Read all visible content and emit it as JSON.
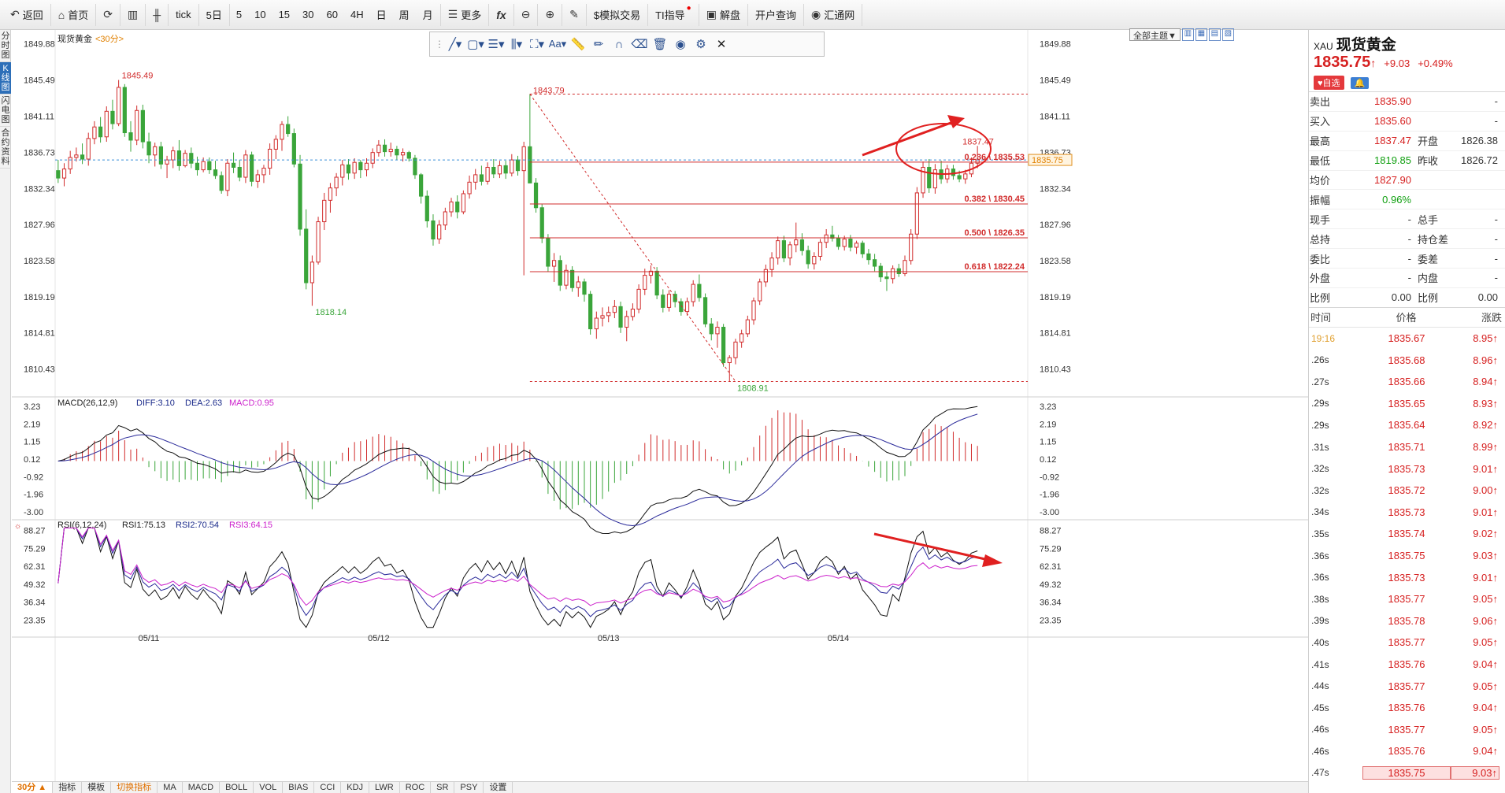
{
  "toolbar": {
    "back": "返回",
    "home": "首页",
    "tick": "tick",
    "period_5d": "5日",
    "p5": "5",
    "p10": "10",
    "p15": "15",
    "p30": "30",
    "p60": "60",
    "p4h": "4H",
    "day": "日",
    "week": "周",
    "month": "月",
    "more": "更多",
    "sim_trade": "$模拟交易",
    "ti": "TI指导",
    "unlock": "解盘",
    "account": "开户查询",
    "fx": "汇通网"
  },
  "left_tabs": [
    "分时图",
    "K线图",
    "闪电图",
    "合约资料"
  ],
  "chart": {
    "title": "现货黄金",
    "period": "<30分>",
    "theme_select": "全部主题▼",
    "price_ticks": [
      "1849.88",
      "1845.49",
      "1841.11",
      "1836.73",
      "1832.34",
      "1827.96",
      "1823.58",
      "1819.19",
      "1814.81",
      "1810.43"
    ],
    "current_price_tag": "1835.75",
    "annotations": {
      "high1": "1845.49",
      "low1": "1818.14",
      "high2": "1843.79",
      "low2": "1808.91",
      "high3": "1837.47"
    },
    "fib_levels": [
      {
        "label": "0.236 \\ 1835.53",
        "price": 1835.53
      },
      {
        "label": "0.382 \\ 1830.45",
        "price": 1830.45
      },
      {
        "label": "0.500 \\ 1826.35",
        "price": 1826.35
      },
      {
        "label": "0.618 \\ 1822.24",
        "price": 1822.24
      }
    ],
    "dates": [
      "05/11",
      "05/12",
      "05/13",
      "05/14"
    ],
    "macd": {
      "label": "MACD(26,12,9)",
      "diff": "DIFF:3.10",
      "dea": "DEA:2.63",
      "macd": "MACD:0.95",
      "ticks": [
        "3.23",
        "2.19",
        "1.15",
        "0.12",
        "-0.92",
        "-1.96",
        "-3.00"
      ]
    },
    "rsi": {
      "label": "RSI(6,12,24)",
      "rsi1": "RSI1:75.13",
      "rsi2": "RSI2:70.54",
      "rsi3": "RSI3:64.15",
      "ticks": [
        "88.27",
        "75.29",
        "62.31",
        "49.32",
        "36.34",
        "23.35"
      ]
    }
  },
  "bottom_bar": [
    "30分 ▲",
    "指标",
    "模板",
    "切换指标",
    "MA",
    "MACD",
    "BOLL",
    "VOL",
    "BIAS",
    "CCI",
    "KDJ",
    "LWR",
    "ROC",
    "SR",
    "PSY",
    "设置"
  ],
  "quote": {
    "code": "XAU",
    "name": "现货黄金",
    "last": "1835.75",
    "arrow": "↑",
    "change": "+9.03",
    "pct": "+0.49%",
    "fav": "♥自选",
    "bell": "🔔",
    "rows": [
      {
        "l1": "卖出",
        "v1": "1835.90",
        "c1": "red",
        "l2": "",
        "v2": "-"
      },
      {
        "l1": "买入",
        "v1": "1835.60",
        "c1": "red",
        "l2": "",
        "v2": "-"
      },
      {
        "l1": "最高",
        "v1": "1837.47",
        "c1": "red",
        "l2": "开盘",
        "v2": "1826.38",
        "c2": "green"
      },
      {
        "l1": "最低",
        "v1": "1819.85",
        "c1": "green",
        "l2": "昨收",
        "v2": "1826.72",
        "c2": "black"
      },
      {
        "l1": "均价",
        "v1": "1827.90",
        "c1": "red",
        "l2": "",
        "v2": ""
      },
      {
        "l1": "振幅",
        "v1": "0.96%",
        "c1": "green",
        "l2": "",
        "v2": ""
      },
      {
        "l1": "现手",
        "v1": "-",
        "c1": "black",
        "l2": "总手",
        "v2": "-"
      },
      {
        "l1": "总持",
        "v1": "-",
        "c1": "black",
        "l2": "持仓差",
        "v2": "-"
      },
      {
        "l1": "委比",
        "v1": "-",
        "c1": "black",
        "l2": "委差",
        "v2": "-"
      },
      {
        "l1": "外盘",
        "v1": "-",
        "c1": "black",
        "l2": "内盘",
        "v2": "-"
      },
      {
        "l1": "比例",
        "v1": "0.00",
        "c1": "black",
        "l2": "比例",
        "v2": "0.00"
      }
    ],
    "tick_header": {
      "time": "时间",
      "price": "价格",
      "change": "涨跌"
    },
    "ticks": [
      {
        "t": "19:16",
        "p": "1835.67",
        "c": "8.95"
      },
      {
        "t": ".26s",
        "p": "1835.68",
        "c": "8.96"
      },
      {
        "t": ".27s",
        "p": "1835.66",
        "c": "8.94"
      },
      {
        "t": ".29s",
        "p": "1835.65",
        "c": "8.93"
      },
      {
        "t": ".29s",
        "p": "1835.64",
        "c": "8.92"
      },
      {
        "t": ".31s",
        "p": "1835.71",
        "c": "8.99"
      },
      {
        "t": ".32s",
        "p": "1835.73",
        "c": "9.01"
      },
      {
        "t": ".32s",
        "p": "1835.72",
        "c": "9.00"
      },
      {
        "t": ".34s",
        "p": "1835.73",
        "c": "9.01"
      },
      {
        "t": ".35s",
        "p": "1835.74",
        "c": "9.02"
      },
      {
        "t": ".36s",
        "p": "1835.75",
        "c": "9.03"
      },
      {
        "t": ".36s",
        "p": "1835.73",
        "c": "9.01"
      },
      {
        "t": ".38s",
        "p": "1835.77",
        "c": "9.05"
      },
      {
        "t": ".39s",
        "p": "1835.78",
        "c": "9.06"
      },
      {
        "t": ".40s",
        "p": "1835.77",
        "c": "9.05"
      },
      {
        "t": ".41s",
        "p": "1835.76",
        "c": "9.04"
      },
      {
        "t": ".44s",
        "p": "1835.77",
        "c": "9.05"
      },
      {
        "t": ".45s",
        "p": "1835.76",
        "c": "9.04"
      },
      {
        "t": ".46s",
        "p": "1835.77",
        "c": "9.05"
      },
      {
        "t": ".46s",
        "p": "1835.76",
        "c": "9.04"
      },
      {
        "t": ".47s",
        "p": "1835.75",
        "c": "9.03"
      }
    ]
  },
  "chart_data": {
    "type": "candlestick",
    "title": "现货黄金",
    "price_range": [
      1808.0,
      1851.0
    ],
    "candles": [
      [
        1834.5,
        1835.8,
        1833.0,
        1833.6
      ],
      [
        1833.6,
        1835.4,
        1832.6,
        1834.7
      ],
      [
        1834.7,
        1836.9,
        1834.1,
        1836.1
      ],
      [
        1836.1,
        1837.3,
        1835.6,
        1836.4
      ],
      [
        1836.4,
        1837.8,
        1835.3,
        1835.9
      ],
      [
        1835.9,
        1839.1,
        1835.1,
        1838.4
      ],
      [
        1838.4,
        1840.5,
        1837.7,
        1839.8
      ],
      [
        1839.8,
        1841.0,
        1837.9,
        1838.6
      ],
      [
        1838.6,
        1842.3,
        1838.0,
        1841.7
      ],
      [
        1841.7,
        1843.1,
        1839.5,
        1840.2
      ],
      [
        1840.2,
        1845.5,
        1839.9,
        1844.6
      ],
      [
        1844.6,
        1845.0,
        1838.6,
        1839.1
      ],
      [
        1839.1,
        1840.5,
        1836.8,
        1838.2
      ],
      [
        1838.2,
        1842.4,
        1837.6,
        1841.8
      ],
      [
        1841.8,
        1842.5,
        1837.2,
        1838.0
      ],
      [
        1838.0,
        1839.1,
        1835.4,
        1836.4
      ],
      [
        1836.4,
        1837.9,
        1835.0,
        1837.4
      ],
      [
        1837.4,
        1838.0,
        1834.7,
        1835.3
      ],
      [
        1835.3,
        1836.3,
        1833.6,
        1835.8
      ],
      [
        1835.8,
        1837.4,
        1834.8,
        1836.9
      ],
      [
        1836.9,
        1838.2,
        1834.5,
        1835.1
      ],
      [
        1835.1,
        1837.0,
        1834.9,
        1836.6
      ],
      [
        1836.6,
        1837.3,
        1834.8,
        1835.4
      ],
      [
        1835.4,
        1836.2,
        1833.9,
        1834.6
      ],
      [
        1834.6,
        1836.1,
        1834.3,
        1835.6
      ],
      [
        1835.6,
        1836.1,
        1834.1,
        1834.6
      ],
      [
        1834.6,
        1835.7,
        1833.5,
        1833.9
      ],
      [
        1833.9,
        1834.4,
        1831.7,
        1832.1
      ],
      [
        1832.1,
        1835.9,
        1831.4,
        1835.4
      ],
      [
        1835.4,
        1836.7,
        1834.2,
        1834.9
      ],
      [
        1834.9,
        1835.8,
        1833.2,
        1833.7
      ],
      [
        1833.7,
        1837.0,
        1833.0,
        1836.4
      ],
      [
        1836.4,
        1836.8,
        1832.6,
        1833.2
      ],
      [
        1833.2,
        1834.6,
        1832.4,
        1834.0
      ],
      [
        1834.0,
        1835.2,
        1833.0,
        1834.8
      ],
      [
        1834.8,
        1837.8,
        1834.0,
        1837.1
      ],
      [
        1837.1,
        1838.8,
        1835.9,
        1838.3
      ],
      [
        1838.3,
        1840.5,
        1836.9,
        1840.1
      ],
      [
        1840.1,
        1841.1,
        1838.6,
        1839.0
      ],
      [
        1839.0,
        1839.6,
        1834.9,
        1835.3
      ],
      [
        1835.3,
        1836.4,
        1826.6,
        1827.4
      ],
      [
        1827.4,
        1829.8,
        1820.1,
        1820.9
      ],
      [
        1820.9,
        1824.2,
        1818.1,
        1823.4
      ],
      [
        1823.4,
        1828.9,
        1823.1,
        1828.3
      ],
      [
        1828.3,
        1831.8,
        1827.3,
        1830.9
      ],
      [
        1830.9,
        1833.0,
        1829.4,
        1832.4
      ],
      [
        1832.4,
        1834.2,
        1831.4,
        1833.7
      ],
      [
        1833.7,
        1835.8,
        1832.7,
        1835.2
      ],
      [
        1835.2,
        1835.9,
        1833.4,
        1834.2
      ],
      [
        1834.2,
        1836.0,
        1833.5,
        1835.5
      ],
      [
        1835.5,
        1835.8,
        1833.6,
        1834.6
      ],
      [
        1834.6,
        1836.0,
        1833.8,
        1835.4
      ],
      [
        1835.4,
        1837.2,
        1834.8,
        1836.7
      ],
      [
        1836.7,
        1838.2,
        1836.2,
        1837.6
      ],
      [
        1837.6,
        1838.3,
        1836.2,
        1836.8
      ],
      [
        1836.8,
        1837.9,
        1836.2,
        1837.1
      ],
      [
        1837.1,
        1837.5,
        1835.8,
        1836.4
      ],
      [
        1836.4,
        1837.2,
        1835.6,
        1836.7
      ],
      [
        1836.7,
        1836.9,
        1835.6,
        1836.0
      ],
      [
        1836.0,
        1836.4,
        1833.5,
        1834.0
      ],
      [
        1834.0,
        1834.2,
        1830.5,
        1831.4
      ],
      [
        1831.4,
        1832.1,
        1827.6,
        1828.4
      ],
      [
        1828.4,
        1829.2,
        1825.4,
        1826.2
      ],
      [
        1826.2,
        1828.5,
        1825.6,
        1827.9
      ],
      [
        1827.9,
        1830.0,
        1827.3,
        1829.5
      ],
      [
        1829.5,
        1831.2,
        1828.9,
        1830.7
      ],
      [
        1830.7,
        1831.5,
        1828.7,
        1829.5
      ],
      [
        1829.5,
        1832.1,
        1829.2,
        1831.7
      ],
      [
        1831.7,
        1833.9,
        1831.1,
        1833.1
      ],
      [
        1833.1,
        1834.7,
        1832.2,
        1834.0
      ],
      [
        1834.0,
        1835.1,
        1832.7,
        1833.2
      ],
      [
        1833.2,
        1835.5,
        1832.8,
        1834.9
      ],
      [
        1834.9,
        1835.9,
        1833.6,
        1834.1
      ],
      [
        1834.1,
        1835.7,
        1833.6,
        1835.1
      ],
      [
        1835.1,
        1835.7,
        1833.5,
        1834.2
      ],
      [
        1834.2,
        1836.5,
        1833.8,
        1835.8
      ],
      [
        1835.8,
        1836.3,
        1833.9,
        1834.5
      ],
      [
        1834.5,
        1838.0,
        1821.8,
        1837.4
      ],
      [
        1837.4,
        1843.8,
        1836.5,
        1833.0
      ],
      [
        1833.0,
        1833.6,
        1829.4,
        1830.0
      ],
      [
        1830.0,
        1830.4,
        1825.7,
        1826.3
      ],
      [
        1826.3,
        1826.8,
        1822.2,
        1822.9
      ],
      [
        1822.9,
        1824.5,
        1821.0,
        1823.6
      ],
      [
        1823.6,
        1824.2,
        1819.9,
        1820.6
      ],
      [
        1820.6,
        1823.1,
        1820.1,
        1822.4
      ],
      [
        1822.4,
        1822.9,
        1819.8,
        1820.3
      ],
      [
        1820.3,
        1821.7,
        1819.2,
        1821.0
      ],
      [
        1821.0,
        1821.4,
        1818.6,
        1819.5
      ],
      [
        1819.5,
        1819.9,
        1814.6,
        1815.3
      ],
      [
        1815.3,
        1817.4,
        1814.1,
        1816.6
      ],
      [
        1816.6,
        1817.9,
        1815.6,
        1816.9
      ],
      [
        1816.9,
        1818.0,
        1816.1,
        1817.3
      ],
      [
        1817.3,
        1818.8,
        1816.6,
        1818.0
      ],
      [
        1818.0,
        1818.6,
        1814.8,
        1815.5
      ],
      [
        1815.5,
        1817.5,
        1813.8,
        1816.8
      ],
      [
        1816.8,
        1818.4,
        1816.3,
        1817.7
      ],
      [
        1817.7,
        1820.7,
        1817.2,
        1820.1
      ],
      [
        1820.1,
        1822.6,
        1819.4,
        1821.8
      ],
      [
        1821.8,
        1823.0,
        1820.8,
        1822.3
      ],
      [
        1822.3,
        1822.8,
        1818.9,
        1819.4
      ],
      [
        1819.4,
        1820.1,
        1817.3,
        1817.9
      ],
      [
        1817.9,
        1820.0,
        1817.4,
        1819.5
      ],
      [
        1819.5,
        1819.9,
        1817.9,
        1818.6
      ],
      [
        1818.6,
        1819.0,
        1816.9,
        1817.4
      ],
      [
        1817.4,
        1819.1,
        1816.9,
        1818.6
      ],
      [
        1818.6,
        1821.2,
        1818.0,
        1820.7
      ],
      [
        1820.7,
        1821.9,
        1818.6,
        1819.1
      ],
      [
        1819.1,
        1819.6,
        1815.5,
        1815.9
      ],
      [
        1815.9,
        1816.6,
        1813.9,
        1814.7
      ],
      [
        1814.7,
        1816.2,
        1813.0,
        1815.5
      ],
      [
        1815.5,
        1815.9,
        1810.7,
        1811.2
      ],
      [
        1811.2,
        1812.1,
        1808.9,
        1811.8
      ],
      [
        1811.8,
        1814.1,
        1811.0,
        1813.7
      ],
      [
        1813.7,
        1815.2,
        1813.0,
        1814.7
      ],
      [
        1814.7,
        1816.9,
        1814.3,
        1816.4
      ],
      [
        1816.4,
        1819.1,
        1815.8,
        1818.7
      ],
      [
        1818.7,
        1821.4,
        1818.2,
        1821.0
      ],
      [
        1821.0,
        1823.1,
        1820.4,
        1822.5
      ],
      [
        1822.5,
        1824.6,
        1821.6,
        1823.9
      ],
      [
        1823.9,
        1826.5,
        1823.1,
        1826.0
      ],
      [
        1826.0,
        1826.6,
        1823.4,
        1823.9
      ],
      [
        1823.9,
        1825.9,
        1823.0,
        1825.5
      ],
      [
        1825.5,
        1828.2,
        1824.6,
        1826.1
      ],
      [
        1826.1,
        1826.9,
        1824.2,
        1824.8
      ],
      [
        1824.8,
        1825.4,
        1822.6,
        1823.2
      ],
      [
        1823.2,
        1824.6,
        1822.5,
        1824.1
      ],
      [
        1824.1,
        1826.2,
        1823.6,
        1825.8
      ],
      [
        1825.8,
        1827.4,
        1825.1,
        1826.7
      ],
      [
        1826.7,
        1827.8,
        1825.9,
        1826.3
      ],
      [
        1826.3,
        1826.7,
        1824.9,
        1825.3
      ],
      [
        1825.3,
        1826.6,
        1824.8,
        1826.2
      ],
      [
        1826.2,
        1826.7,
        1824.7,
        1825.2
      ],
      [
        1825.2,
        1826.0,
        1824.4,
        1825.7
      ],
      [
        1825.7,
        1826.0,
        1823.9,
        1824.4
      ],
      [
        1824.4,
        1825.0,
        1823.1,
        1823.7
      ],
      [
        1823.7,
        1824.4,
        1822.3,
        1822.9
      ],
      [
        1822.9,
        1823.3,
        1821.0,
        1821.6
      ],
      [
        1821.6,
        1822.2,
        1819.9,
        1821.4
      ],
      [
        1821.4,
        1823.0,
        1820.8,
        1822.6
      ],
      [
        1822.6,
        1823.2,
        1821.6,
        1822.0
      ],
      [
        1822.0,
        1824.2,
        1821.7,
        1823.6
      ],
      [
        1823.6,
        1827.4,
        1823.1,
        1826.8
      ],
      [
        1826.8,
        1832.5,
        1826.2,
        1831.8
      ],
      [
        1831.8,
        1835.6,
        1831.2,
        1834.9
      ],
      [
        1834.9,
        1835.9,
        1831.8,
        1832.4
      ],
      [
        1832.4,
        1835.3,
        1831.7,
        1834.6
      ],
      [
        1834.6,
        1835.7,
        1832.9,
        1833.5
      ],
      [
        1833.5,
        1835.2,
        1833.0,
        1834.7
      ],
      [
        1834.7,
        1835.2,
        1833.4,
        1833.9
      ],
      [
        1833.9,
        1834.5,
        1833.1,
        1833.5
      ],
      [
        1833.5,
        1834.6,
        1832.9,
        1834.1
      ],
      [
        1834.1,
        1836.1,
        1833.7,
        1835.4
      ],
      [
        1835.4,
        1837.5,
        1834.8,
        1835.8
      ]
    ],
    "fibonacci": {
      "high": 1843.79,
      "low": 1808.91,
      "levels": [
        0.236,
        0.382,
        0.5,
        0.618
      ]
    }
  }
}
